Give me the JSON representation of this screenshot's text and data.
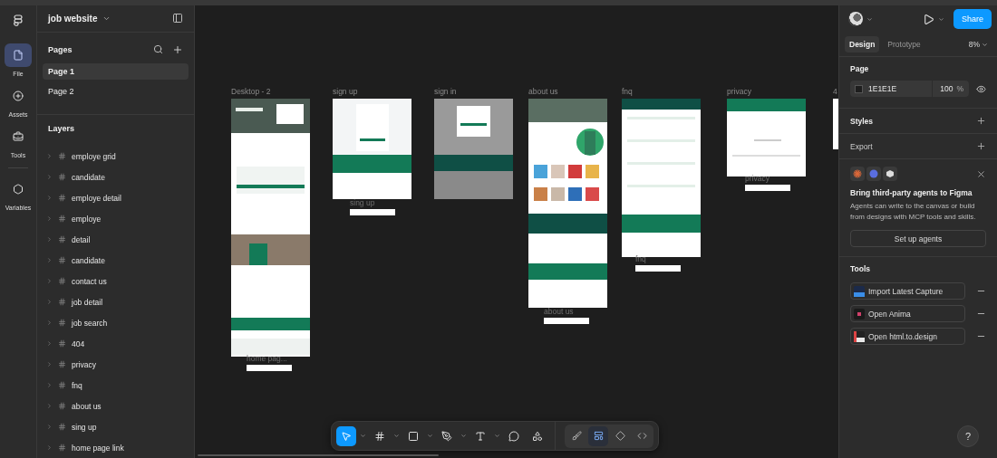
{
  "file": {
    "name": "job website"
  },
  "rail": [
    {
      "label": "File",
      "kind": "file",
      "selected": true
    },
    {
      "label": "Assets",
      "kind": "assets",
      "selected": false
    },
    {
      "label": "Tools",
      "kind": "tools",
      "selected": false
    },
    {
      "label": "Variables",
      "kind": "variables",
      "selected": false
    }
  ],
  "pages": {
    "title": "Pages",
    "items": [
      {
        "label": "Page 1",
        "selected": true
      },
      {
        "label": "Page 2",
        "selected": false
      }
    ]
  },
  "layers": {
    "title": "Layers",
    "items": [
      {
        "label": "employe grid",
        "expanded": false
      },
      {
        "label": "candidate",
        "expanded": false
      },
      {
        "label": "employe detail",
        "expanded": false
      },
      {
        "label": "employe",
        "expanded": false
      },
      {
        "label": "detail",
        "expanded": false
      },
      {
        "label": "candidate",
        "expanded": false
      },
      {
        "label": "contact us",
        "expanded": false
      },
      {
        "label": "job detail",
        "expanded": false
      },
      {
        "label": "job search",
        "expanded": false
      },
      {
        "label": "404",
        "expanded": false
      },
      {
        "label": "privacy",
        "expanded": false
      },
      {
        "label": "fnq",
        "expanded": false
      },
      {
        "label": "about us",
        "expanded": false
      },
      {
        "label": "sing up",
        "expanded": false
      },
      {
        "label": "home page link",
        "expanded": false
      }
    ]
  },
  "canvas": {
    "frames": [
      {
        "label": "Desktop - 2",
        "kind": "home",
        "caption": "home pag..."
      },
      {
        "label": "sign up",
        "kind": "form",
        "caption": "sing up"
      },
      {
        "label": "sign in",
        "kind": "signin"
      },
      {
        "label": "about us",
        "kind": "about",
        "caption": "about us"
      },
      {
        "label": "fnq",
        "kind": "faq",
        "caption": "fnq"
      },
      {
        "label": "privacy",
        "kind": "privacy",
        "caption": "privacy"
      },
      {
        "label": "4",
        "kind": "partial"
      }
    ]
  },
  "toolbar": {
    "tools": [
      {
        "kind": "move",
        "selected": true,
        "menu": true
      },
      {
        "kind": "frame",
        "selected": false,
        "menu": true
      },
      {
        "kind": "shape",
        "selected": false,
        "menu": true
      },
      {
        "kind": "pen",
        "selected": false,
        "menu": true
      },
      {
        "kind": "text",
        "selected": false,
        "menu": true
      },
      {
        "kind": "comment",
        "selected": false,
        "menu": false
      },
      {
        "kind": "actions",
        "selected": false,
        "menu": false
      }
    ],
    "modes": [
      {
        "kind": "draw",
        "selected": false
      },
      {
        "kind": "design",
        "selected": true
      },
      {
        "kind": "component",
        "selected": false
      },
      {
        "kind": "code",
        "selected": false
      }
    ]
  },
  "right_panel": {
    "share": "Share",
    "tabs": [
      {
        "label": "Design",
        "selected": true
      },
      {
        "label": "Prototype",
        "selected": false
      }
    ],
    "zoom": "8%",
    "page": {
      "title": "Page",
      "color": "1E1E1E",
      "opacity": "100",
      "unit": "%"
    },
    "styles": "Styles",
    "export": "Export",
    "promo": {
      "title": "Bring third-party agents to Figma",
      "body": "Agents can write to the canvas or build from designs with MCP tools and skills.",
      "button": "Set up agents"
    },
    "tools": {
      "title": "Tools",
      "items": [
        {
          "label": "Import Latest Capture",
          "kind": "capture"
        },
        {
          "label": "Open Anima",
          "kind": "anima"
        },
        {
          "label": "Open html.to.design",
          "kind": "html"
        }
      ]
    },
    "help": "?"
  }
}
